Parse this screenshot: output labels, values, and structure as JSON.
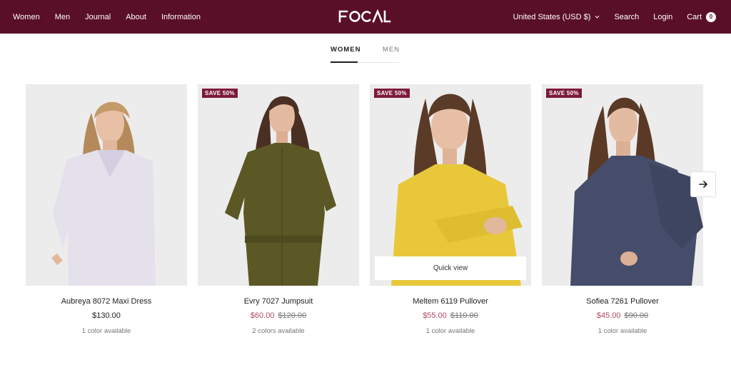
{
  "header": {
    "nav_left": [
      "Women",
      "Men",
      "Journal",
      "About",
      "Information"
    ],
    "logo_text": "FOCAL",
    "country": "United States (USD $)",
    "search": "Search",
    "login": "Login",
    "cart": "Cart",
    "cart_count": "0",
    "colors": {
      "background": "#5a0f28",
      "text": "#ffffff"
    }
  },
  "tabs": [
    {
      "label": "WOMEN",
      "active": true
    },
    {
      "label": "MEN",
      "active": false
    }
  ],
  "products": [
    {
      "title": "Aubreya 8072 Maxi Dress",
      "price": "$130.00",
      "compare_price": "",
      "colors": "1 color available",
      "badge": ""
    },
    {
      "title": "Evry 7027 Jumpsuit",
      "price": "$60.00",
      "compare_price": "$120.00",
      "colors": "2 colors available",
      "badge": "SAVE 50%"
    },
    {
      "title": "Meltem 6119 Pullover",
      "price": "$55.00",
      "compare_price": "$110.00",
      "colors": "1 color available",
      "badge": "SAVE 50%",
      "quick_view": "Quick view"
    },
    {
      "title": "Sofiea 7261 Pullover",
      "price": "$45.00",
      "compare_price": "$90.00",
      "colors": "1 color available",
      "badge": "SAVE 50%"
    }
  ],
  "icons": {
    "next": "arrow-right-icon",
    "dropdown": "chevron-down-icon"
  },
  "accent": {
    "badge": "#7d1a3c",
    "sale_price": "#b14a5f"
  }
}
